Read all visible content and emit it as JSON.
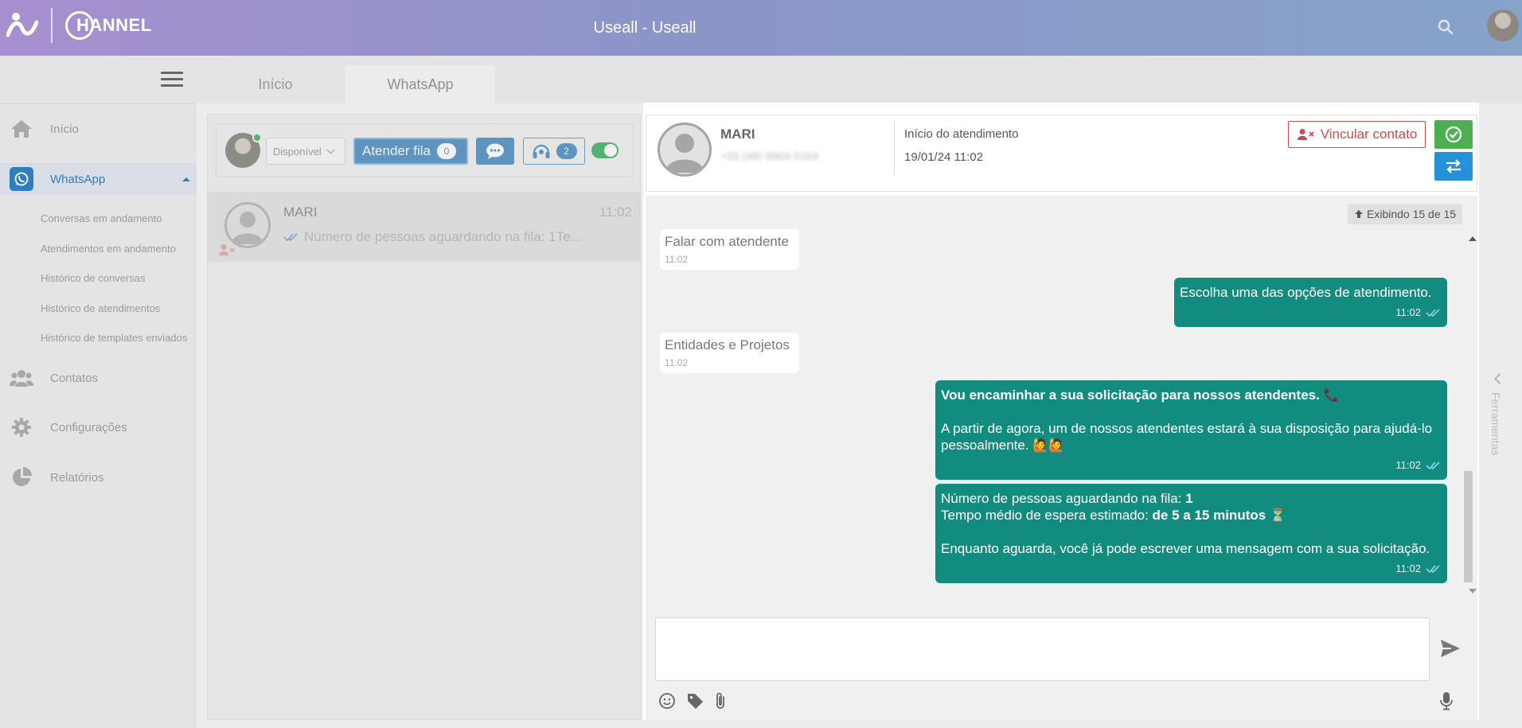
{
  "header": {
    "logo_text": "HANNEL",
    "title": "Useall - Useall"
  },
  "sidebar": {
    "items": [
      {
        "label": "Início",
        "icon": "home-icon"
      },
      {
        "label": "WhatsApp",
        "icon": "whatsapp-icon"
      },
      {
        "label": "Contatos",
        "icon": "contacts-icon"
      },
      {
        "label": "Configurações",
        "icon": "gear-icon"
      },
      {
        "label": "Relatórios",
        "icon": "pie-chart-icon"
      }
    ],
    "sub_items": [
      "Conversas em andamento",
      "Atendimentos em andamento",
      "Histórico de conversas",
      "Histórico de atendimentos",
      "Histórico de templates enviados"
    ]
  },
  "tabs": [
    {
      "label": "Início"
    },
    {
      "label": "WhatsApp"
    }
  ],
  "toolbar": {
    "status": "Disponível",
    "queue_label": "Atender fila",
    "queue_count": "0",
    "agents_count": "2"
  },
  "conversation": {
    "name": "MARI",
    "time": "11:02",
    "preview": "Número de pessoas aguardando na fila: 1Te..."
  },
  "chat": {
    "contact_name": "MARI",
    "contact_phone": "+55 (48) 9964-5164",
    "start_label": "Início do atendimento",
    "start_value": "19/01/24 11:02",
    "link_contact_label": "Vincular contato",
    "showing_label": "Exibindo 15 de 15",
    "messages": [
      {
        "dir": "in",
        "text": "Falar com atendente",
        "time": "11:02"
      },
      {
        "dir": "out",
        "text": "Escolha uma das opções de atendimento.",
        "time": "11:02"
      },
      {
        "dir": "in",
        "text": "Entidades e Projetos",
        "time": "11:02"
      },
      {
        "dir": "out",
        "bold_line": "Vou encaminhar a sua solicitação para nossos atendentes.",
        "line2": "A partir de agora, um de nossos atendentes estará à sua disposição para ajudá-lo pessoalmente.",
        "time": "11:02"
      },
      {
        "dir": "out",
        "queue_prefix": "Número de pessoas aguardando na fila: ",
        "queue_value": "1",
        "wait_prefix": "Tempo médio de espera estimado: ",
        "wait_value": "de 5 a 15 minutos",
        "line3": "Enquanto aguarda, você já pode escrever uma mensagem com a sua solicitação.",
        "time": "11:02"
      }
    ],
    "composer_placeholder": ""
  },
  "tools_drawer_label": "Ferramentas",
  "colors": {
    "accent": "#2d7fc1",
    "outgoing_bubble": "#128c7e",
    "finish_green": "#4cb051",
    "transfer_blue": "#2591d9",
    "danger": "#d24a4a"
  }
}
